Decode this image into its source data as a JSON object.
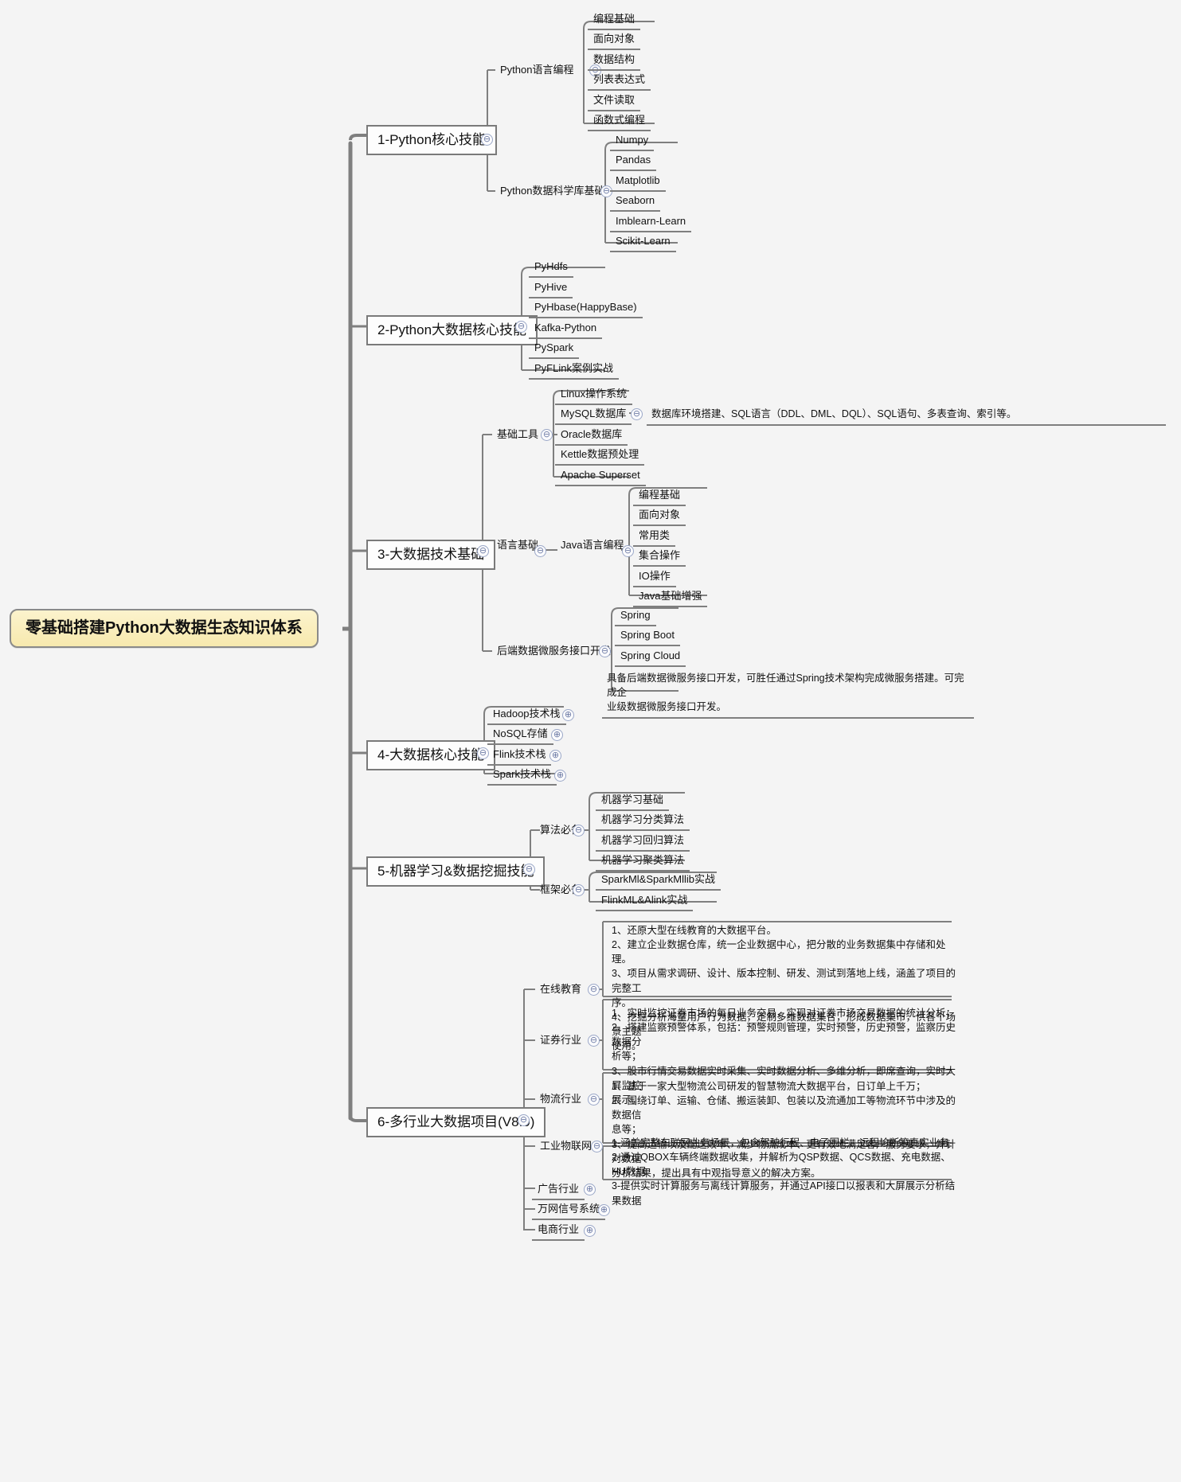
{
  "meta": {
    "root_color": "#f7e9ae",
    "line_color": "#7f7f7f",
    "background": "#f4f4f4",
    "toggle_color": "#6d7ba5"
  },
  "root": {
    "label": "零基础搭建Python大数据生态知识体系"
  },
  "branches": [
    {
      "label": "1-Python核心技能",
      "toggle": "collapse",
      "groups": [
        {
          "label": "Python语言编程",
          "toggle": "collapse",
          "items": [
            {
              "label": "编程基础"
            },
            {
              "label": "面向对象"
            },
            {
              "label": "数据结构"
            },
            {
              "label": "列表表达式"
            },
            {
              "label": "文件读取"
            },
            {
              "label": "函数式编程"
            }
          ]
        },
        {
          "label": "Python数据科学库基础",
          "toggle": "collapse",
          "items": [
            {
              "label": "Numpy"
            },
            {
              "label": "Pandas"
            },
            {
              "label": "Matplotlib"
            },
            {
              "label": "Seaborn"
            },
            {
              "label": "Imblearn-Learn"
            },
            {
              "label": "Scikit-Learn"
            }
          ]
        }
      ]
    },
    {
      "label": "2-Python大数据核心技能",
      "toggle": "collapse",
      "groups": [
        {
          "label": "",
          "items": [
            {
              "label": "PyHdfs"
            },
            {
              "label": "PyHive"
            },
            {
              "label": "PyHbase(HappyBase)"
            },
            {
              "label": "Kafka-Python"
            },
            {
              "label": "PySpark"
            },
            {
              "label": "PyFLink案例实战"
            }
          ]
        }
      ]
    },
    {
      "label": "3-大数据技术基础",
      "toggle": "collapse",
      "groups": [
        {
          "label": "基础工具",
          "toggle": "collapse",
          "items": [
            {
              "label": "Linux操作系统"
            },
            {
              "label": "MySQL数据库",
              "toggle": "collapse",
              "note": "数据库环境搭建、SQL语言（DDL、DML、DQL）、SQL语句、多表查询、索引等。"
            },
            {
              "label": "Oracle数据库"
            },
            {
              "label": "Kettle数据预处理"
            },
            {
              "label": "Apache Superset"
            }
          ]
        },
        {
          "label": "语言基础",
          "toggle": "collapse",
          "sub": {
            "label": "Java语言编程",
            "toggle": "collapse",
            "items": [
              {
                "label": "编程基础"
              },
              {
                "label": "面向对象"
              },
              {
                "label": "常用类"
              },
              {
                "label": "集合操作"
              },
              {
                "label": "IO操作"
              },
              {
                "label": "Java基础增强"
              }
            ]
          }
        },
        {
          "label": "后端数据微服务接口开发",
          "toggle": "collapse",
          "items": [
            {
              "label": "Spring"
            },
            {
              "label": "Spring Boot"
            },
            {
              "label": "Spring Cloud"
            }
          ],
          "note": "具备后端数据微服务接口开发，可胜任通过Spring技术架构完成微服务搭建。可完成企\n业级数据微服务接口开发。"
        }
      ]
    },
    {
      "label": "4-大数据核心技能",
      "toggle": "collapse",
      "groups": [
        {
          "label": "",
          "items": [
            {
              "label": "Hadoop技术栈",
              "toggle": "expand"
            },
            {
              "label": "NoSQL存储",
              "toggle": "expand"
            },
            {
              "label": "Flink技术栈",
              "toggle": "expand"
            },
            {
              "label": "Spark技术栈",
              "toggle": "expand"
            }
          ]
        }
      ]
    },
    {
      "label": "5-机器学习&数据挖掘技能",
      "toggle": "collapse",
      "groups": [
        {
          "label": "算法必备",
          "toggle": "collapse",
          "items": [
            {
              "label": "机器学习基础"
            },
            {
              "label": "机器学习分类算法"
            },
            {
              "label": "机器学习回归算法"
            },
            {
              "label": "机器学习聚类算法"
            }
          ]
        },
        {
          "label": "框架必备",
          "toggle": "collapse",
          "items": [
            {
              "label": "SparkMl&SparkMllib实战"
            },
            {
              "label": "FlinkML&Alink实战"
            }
          ]
        }
      ]
    },
    {
      "label": "6-多行业大数据项目(V8.0)",
      "toggle": "collapse",
      "industries": [
        {
          "label": "在线教育",
          "toggle": "collapse",
          "note": "1、还原大型在线教育的大数据平台。\n2、建立企业数据仓库，统一企业数据中心，把分散的业务数据集中存储和处理。\n3、项目从需求调研、设计、版本控制、研发、测试到落地上线，涵盖了项目的完整工\n序。\n4、挖掘分析海量用户行为数据，定制多维数据集合，形成数据集市，供各个场景主题\n使用。"
        },
        {
          "label": "证券行业",
          "toggle": "collapse",
          "note": "1、实时监控证券市场的每日业务交易，实现对证券市场交易数据的统计分析；\n2、搭建监察预警体系，包括：预警规则管理，实时预警，历史预警，监察历史数据分\n析等；\n3、股市行情交易数据实时采集、实时数据分析、多维分析，即席查询，实时大屏监控\n展示。"
        },
        {
          "label": "物流行业",
          "toggle": "collapse",
          "note": "1、基于一家大型物流公司研发的智慧物流大数据平台，日订单上千万；\n2、围绕订单、运输、仓储、搬运装卸、包装以及流通加工等物流环节中涉及的数据信\n息等；\n3、提高运输以及配送效率、减少物流成本、更有效地满足客户服务要求，并针对数据\n分析结果，提出具有中观指导意义的解决方案。"
        },
        {
          "label": "工业物联网",
          "toggle": "collapse",
          "note": "1-涵盖完整车联网业务场景，包含驾驶行程、电子围栏、远程诊断等真实业务\n2-通过QBOX车辆终端数据收集，并解析为QSP数据、QCS数据、充电数据、HU数据\n3-提供实时计算服务与离线计算服务，并通过API接口以报表和大屏展示分析结果数据"
        },
        {
          "label": "广告行业",
          "toggle": "expand"
        },
        {
          "label": "万网信号系统",
          "toggle": "expand"
        },
        {
          "label": "电商行业",
          "toggle": "expand"
        }
      ]
    }
  ]
}
